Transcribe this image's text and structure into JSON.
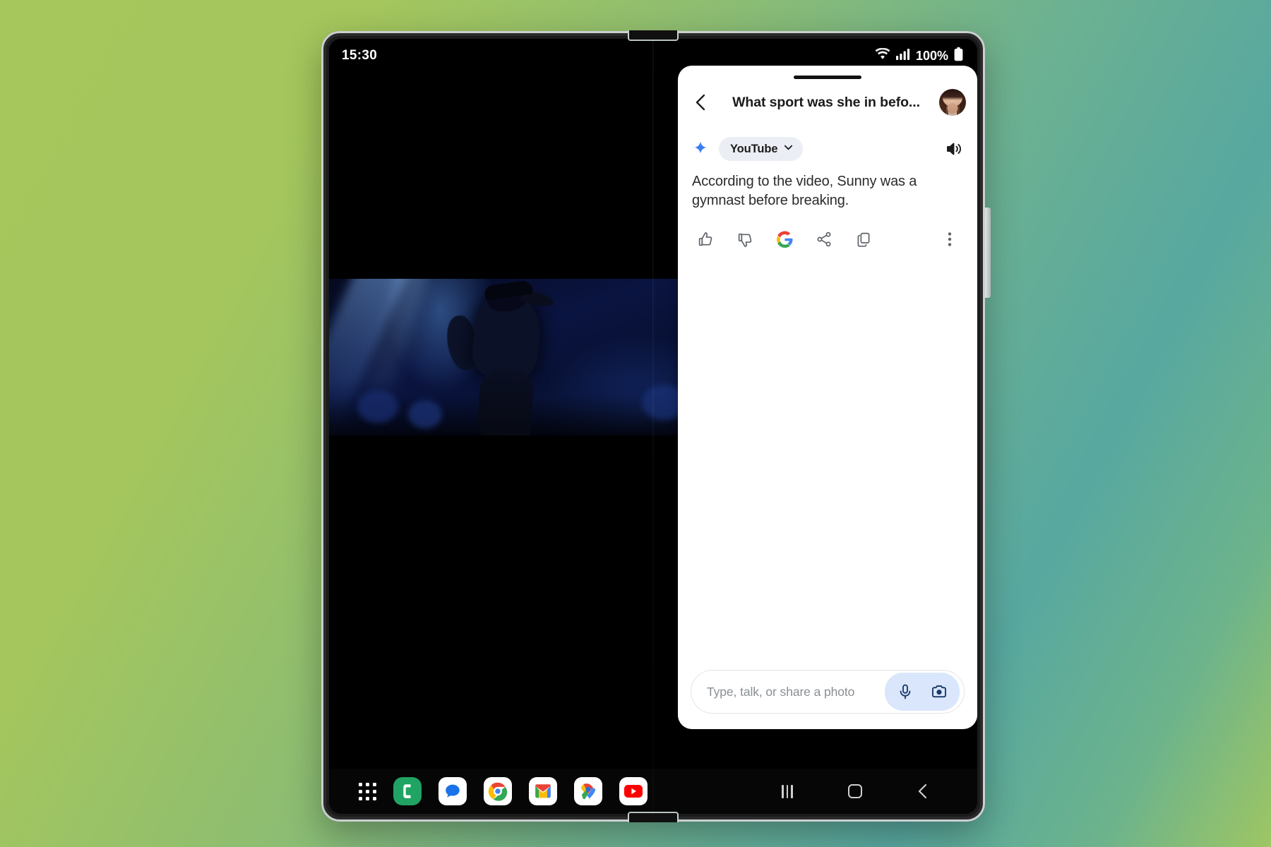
{
  "wallpaper": {
    "color_start": "#a6c75c",
    "color_end": "#58a8a0"
  },
  "status_bar": {
    "time": "15:30",
    "battery_percent": "100%",
    "icons": [
      "wifi-icon",
      "cellular-signal-icon",
      "battery-icon"
    ]
  },
  "assistant_panel": {
    "drag_handle": "drag-handle",
    "back_label": "Back",
    "title": "What sport was she in befo...",
    "avatar_label": "User account avatar",
    "source": {
      "sparkle_icon": "gemini-sparkle-icon",
      "chip_label": "YouTube",
      "chip_chevron": "chevron-down-icon",
      "speaker_icon": "speaker-icon"
    },
    "answer": "According to the video, Sunny was a gymnast before breaking.",
    "actions": [
      {
        "name": "thumbs-up-button",
        "label": "Thumbs up"
      },
      {
        "name": "thumbs-down-button",
        "label": "Thumbs down"
      },
      {
        "name": "google-search-button",
        "label": "Google it"
      },
      {
        "name": "share-button",
        "label": "Share"
      },
      {
        "name": "copy-button",
        "label": "Copy"
      },
      {
        "name": "overflow-button",
        "label": "More options"
      }
    ],
    "composer": {
      "placeholder": "Type, talk, or share a photo",
      "value": "",
      "mic_label": "Voice input",
      "camera_label": "Camera input"
    }
  },
  "video": {
    "description": "Dancer performing on a blue-lit stage"
  },
  "dock": {
    "items": [
      {
        "name": "app-drawer-icon",
        "label": "Apps"
      },
      {
        "name": "phone-icon",
        "label": "Phone"
      },
      {
        "name": "messages-icon",
        "label": "Messages"
      },
      {
        "name": "chrome-icon",
        "label": "Chrome"
      },
      {
        "name": "gmail-icon",
        "label": "Gmail"
      },
      {
        "name": "maps-icon",
        "label": "Maps"
      },
      {
        "name": "youtube-icon",
        "label": "YouTube"
      }
    ]
  },
  "nav_bar": {
    "recents_label": "Recents",
    "home_label": "Home",
    "back_label": "Back"
  },
  "colors": {
    "accent_blue": "#4285F4",
    "chip_bg": "#eceef5",
    "composer_pill": "#d9e6fb"
  }
}
